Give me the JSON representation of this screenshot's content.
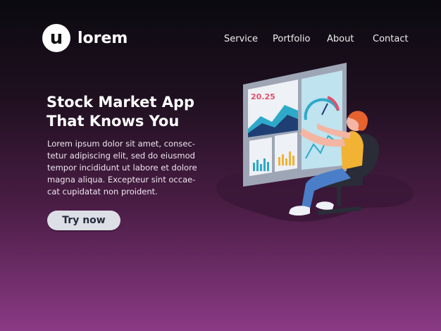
{
  "brand": {
    "logo_letter": "u",
    "name": "lorem"
  },
  "nav": {
    "items": [
      {
        "label": "Service"
      },
      {
        "label": "Portfolio"
      },
      {
        "label": "About"
      },
      {
        "label": "Contact"
      }
    ]
  },
  "hero": {
    "title_lines": [
      "Stock Market App",
      "That Knows You"
    ],
    "body_lines": [
      "Lorem ipsum dolor sit amet, consec-",
      "tetur adipiscing elit, sed do eiusmod",
      "tempor incididunt ut labore et dolore",
      "magna aliqua. Excepteur sint occae-",
      "cat cupidatat non proident."
    ],
    "cta_label": "Try now"
  },
  "illustration": {
    "dashboard_value": "20.25"
  },
  "colors": {
    "accent_pink": "#e0516b",
    "chart_teal": "#2fa9c9",
    "chart_navy": "#1f3f74",
    "button_bg": "#dcdfe6",
    "gradient_top": "#0b0a10",
    "gradient_bottom": "#8a3a84"
  }
}
